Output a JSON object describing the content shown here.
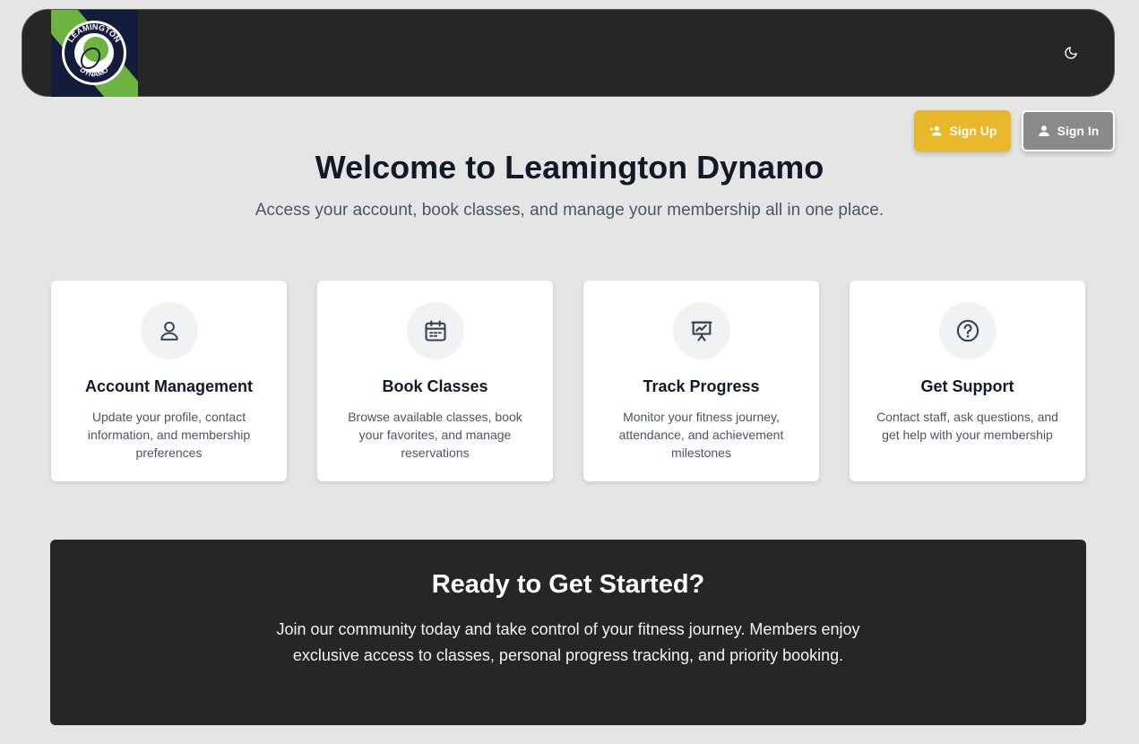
{
  "header": {
    "logo_text": "LEAMINGTON DYNAMO",
    "theme_toggle_icon": "moon-icon"
  },
  "auth": {
    "signup_label": "Sign Up",
    "signup_icon": "user-plus-icon",
    "signin_label": "Sign In",
    "signin_icon": "user-icon"
  },
  "hero": {
    "title": "Welcome to Leamington Dynamo",
    "subtitle": "Access your account, book classes, and manage your membership all in one place."
  },
  "features": [
    {
      "icon": "user-icon",
      "title": "Account Management",
      "description": "Update your profile, contact information, and membership preferences"
    },
    {
      "icon": "calendar-icon",
      "title": "Book Classes",
      "description": "Browse available classes, book your favorites, and manage reservations"
    },
    {
      "icon": "presentation-chart-icon",
      "title": "Track Progress",
      "description": "Monitor your fitness journey, attendance, and achievement milestones"
    },
    {
      "icon": "help-circle-icon",
      "title": "Get Support",
      "description": "Contact staff, ask questions, and get help with your membership"
    }
  ],
  "cta": {
    "title": "Ready to Get Started?",
    "text": "Join our community today and take control of your fitness journey. Members enjoy exclusive access to classes, personal progress tracking, and priority booking."
  },
  "colors": {
    "background": "#e5e5e5",
    "header_bg": "#262626",
    "signup_bg": "#e8b72a",
    "signin_bg": "#8a8a8a",
    "logo_green": "#6db33f",
    "logo_navy": "#141c3c"
  }
}
